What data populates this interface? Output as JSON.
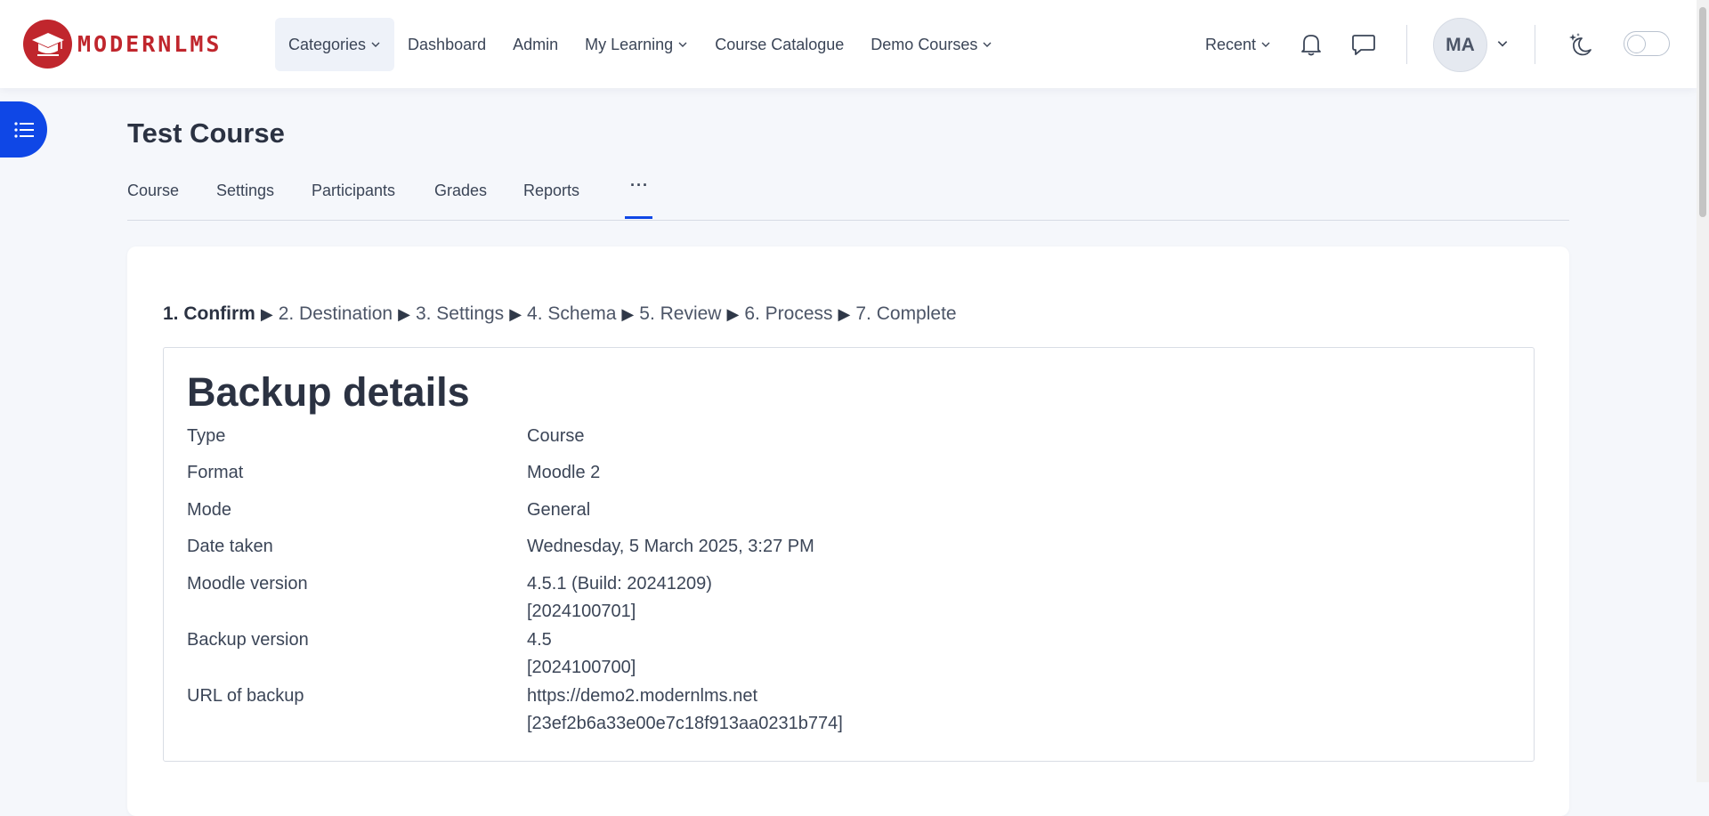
{
  "brand": {
    "name": "MODERNLMS",
    "colors": {
      "brand": "#c0262d",
      "accent": "#0f47e6"
    }
  },
  "nav": {
    "items": [
      {
        "label": "Categories",
        "has_dropdown": true,
        "active": true
      },
      {
        "label": "Dashboard",
        "has_dropdown": false
      },
      {
        "label": "Admin",
        "has_dropdown": false
      },
      {
        "label": "My Learning",
        "has_dropdown": true
      },
      {
        "label": "Course Catalogue",
        "has_dropdown": false
      },
      {
        "label": "Demo Courses",
        "has_dropdown": true
      }
    ],
    "recent_label": "Recent",
    "icons": [
      "bell-icon",
      "chat-icon",
      "moon-stars-icon"
    ],
    "user_initials": "MA"
  },
  "page": {
    "title": "Test Course",
    "tabs": [
      {
        "label": "Course"
      },
      {
        "label": "Settings"
      },
      {
        "label": "Participants"
      },
      {
        "label": "Grades"
      },
      {
        "label": "Reports"
      },
      {
        "label": "···"
      }
    ]
  },
  "steps": {
    "items": [
      {
        "label": "1. Confirm",
        "current": true
      },
      {
        "label": "2. Destination"
      },
      {
        "label": "3. Settings"
      },
      {
        "label": "4. Schema"
      },
      {
        "label": "5. Review"
      },
      {
        "label": "6. Process"
      },
      {
        "label": "7. Complete"
      }
    ],
    "separator": "▶"
  },
  "details": {
    "title": "Backup details",
    "rows": [
      {
        "label": "Type",
        "value_lines": [
          "Course"
        ]
      },
      {
        "label": "Format",
        "value_lines": [
          "Moodle 2"
        ]
      },
      {
        "label": "Mode",
        "value_lines": [
          "General"
        ]
      },
      {
        "label": "Date taken",
        "value_lines": [
          "Wednesday, 5 March 2025, 3:27 PM"
        ]
      },
      {
        "label": "Moodle version",
        "value_lines": [
          "4.5.1 (Build: 20241209)",
          "[2024100701]"
        ]
      },
      {
        "label": "Backup version",
        "value_lines": [
          "4.5",
          "[2024100700]"
        ]
      },
      {
        "label": "URL of backup",
        "value_lines": [
          "https://demo2.modernlms.net",
          "[23ef2b6a33e00e7c18f913aa0231b774]"
        ]
      }
    ]
  }
}
